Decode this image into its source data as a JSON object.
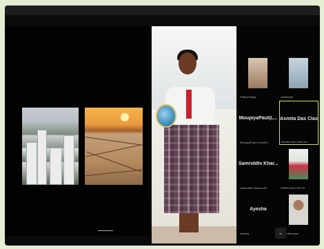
{
  "participants": [
    {
      "id": "p1",
      "name": "",
      "caption": "Pratiba Bajaj"
    },
    {
      "id": "p2",
      "name": "",
      "caption": "Jonibekari"
    },
    {
      "id": "p3",
      "name": "MoupiyaPaul(L...",
      "caption": "MoupiyaPaul.LeveldGv"
    },
    {
      "id": "p4",
      "name": "Asmita Das Clas...",
      "caption": "Asmita Das Class 6-4"
    },
    {
      "id": "p5",
      "name": "Samriddhi  Khar...",
      "caption": "Samriddhi Kharkar Bh"
    },
    {
      "id": "p6",
      "name": "",
      "caption": "SHREYASH DATTA"
    },
    {
      "id": "p7",
      "name": "Ayesha",
      "caption": "Ayesha"
    },
    {
      "id": "p8",
      "name": "",
      "caption": "Rhivi Banerjee"
    }
  ],
  "controls": {
    "scroll_down_icon": "chevron-down-icon",
    "scroll_symbol": "⌄"
  },
  "colors": {
    "active_border": "#d5e070",
    "background": "#e5edd4"
  }
}
